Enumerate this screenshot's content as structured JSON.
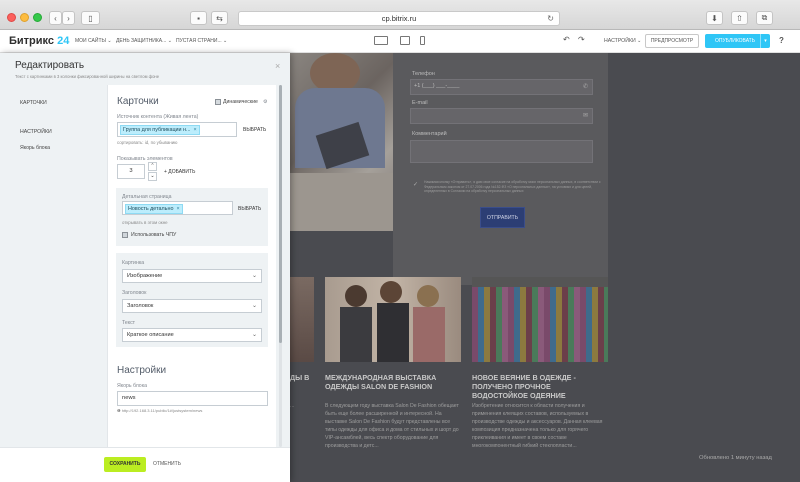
{
  "browser": {
    "url": "cp.bitrix.ru"
  },
  "topbar": {
    "logo_main": "Битрикс",
    "logo_num": "24",
    "nav": [
      "МОИ САЙТЫ",
      "ДЕНЬ ЗАЩИТНИКА...",
      "ПУСТАЯ СТРАНИ..."
    ],
    "settings": "НАСТРОЙКИ",
    "preview": "ПРЕДПРОСМОТР",
    "publish": "ОПУБЛИКОВАТЬ",
    "help": "?"
  },
  "page": {
    "form": {
      "phone_label": "Телефон",
      "phone_value": "+1 (___) ___-____",
      "email_label": "E-mail",
      "comment_label": "Комментарий",
      "consent": "Нажимая кнопку «Отправить», я даю свое согласие на обработку моих персональных данных, в соответствии с Федеральным законом от 27.07.2006 года №152-ФЗ «О персональных данных», на условиях и для целей, определенных в Согласии на обработку персональных данных",
      "submit": "ОТПРАВИТЬ"
    },
    "cards": [
      {
        "title": "ДЫ В",
        "text": "..."
      },
      {
        "title": "МЕЖДУНАРОДНАЯ ВЫСТАВКА ОДЕЖДЫ SALON DE FASHION",
        "text": "В следующем году выставка Salon De Fashion обещает быть еще более расширенной и интересной. На выставке Salon De Fashion будут представлены все типы одежды для офиса и дома от стильных и шорт до VIP-ансамблей, весь спектр оборудование для производства и детс..."
      },
      {
        "title": "НОВОЕ ВЕЯНИЕ В ОДЕЖДЕ - ПОЛУЧЕНО ПРОЧНОЕ ВОДОСТОЙКОЕ ОДЕЯНИЕ",
        "text": "Изобретение относится к области получения и применения клеящих составов, используемых в производстве одежды и аксессуаров. Данная клеевая композиция предназначена только для горячего приклеивания и имеет в своем составе многокомпонентный гибкий стеклопласти..."
      }
    ],
    "updated": "Обновлено 1 минуту назад"
  },
  "panel": {
    "title": "Редактировать",
    "subtitle": "Текст с картинками в 3 колонки фиксированной ширины на светлом фоне",
    "nav": [
      "КАРТОЧКИ",
      "НАСТРОЙКИ",
      "Якорь блока"
    ],
    "cards_section": {
      "title": "Карточки",
      "dynamic_label": "Динамические",
      "source_label": "Источник контента (Живая лента)",
      "source_tag": "Группа для публикации н...",
      "select_btn": "ВЫБРАТЬ",
      "sort_note": "сортировать: id, по убыванию",
      "show_label": "Показывать элементов",
      "show_value": "3",
      "add_btn": "+ ДОБАВИТЬ",
      "detail_label": "Детальная страница",
      "detail_tag": "Новость детально",
      "detail_select": "ВЫБРАТЬ",
      "open_note": "открывать в этом окне",
      "cpu_label": "Использовать ЧПУ",
      "picture_label": "Картинка",
      "picture_value": "Изображение",
      "heading_label": "Заголовок",
      "heading_value": "Заголовок",
      "text_label": "Текст",
      "text_value": "Краткое описание"
    },
    "settings_section": {
      "title": "Настройки",
      "anchor_label": "Якорь блока",
      "anchor_value": "news",
      "anchor_url": "http://192.168.3.11/public/1#/justsystem/news"
    },
    "footer": {
      "save": "СОХРАНИТЬ",
      "cancel": "ОТМЕНИТЬ"
    }
  },
  "colors": {
    "accent": "#2fc6f6",
    "save": "#bbed21"
  }
}
